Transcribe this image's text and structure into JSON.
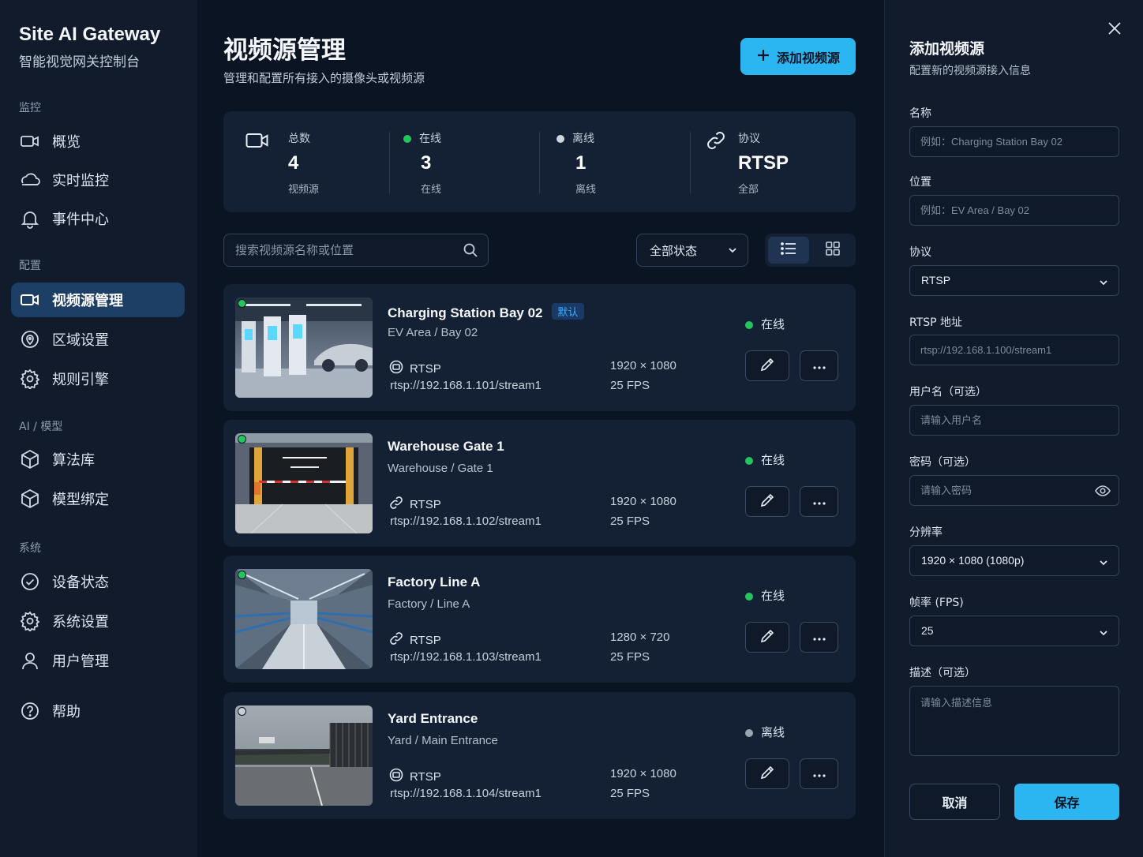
{
  "brand": {
    "title": "Site AI Gateway",
    "subtitle": "智能视觉网关控制台"
  },
  "sidebar": {
    "sections": [
      {
        "label": "监控"
      },
      {
        "label": "配置"
      },
      {
        "label": "AI / 模型"
      },
      {
        "label": "系统"
      }
    ],
    "items": [
      {
        "label": "概览",
        "icon": "video-icon"
      },
      {
        "label": "实时监控",
        "icon": "cloud-icon"
      },
      {
        "label": "事件中心",
        "icon": "bell-icon"
      },
      {
        "label": "视频源管理",
        "icon": "video-icon",
        "active": true
      },
      {
        "label": "区域设置",
        "icon": "map-pin-icon"
      },
      {
        "label": "规则引擎",
        "icon": "gear-icon"
      },
      {
        "label": "算法库",
        "icon": "cube-icon"
      },
      {
        "label": "模型绑定",
        "icon": "cube-icon"
      },
      {
        "label": "设备状态",
        "icon": "check-circle-icon"
      },
      {
        "label": "系统设置",
        "icon": "gear-icon"
      },
      {
        "label": "用户管理",
        "icon": "user-icon"
      },
      {
        "label": "帮助",
        "icon": "help-circle-icon"
      }
    ]
  },
  "header": {
    "title": "视频源管理",
    "subtitle": "管理和配置所有接入的摄像头或视频源",
    "add_label": "添加视频源"
  },
  "stats": {
    "total": {
      "label": "总数",
      "value": "4",
      "sub": "视频源"
    },
    "online": {
      "label": "在线",
      "value": "3",
      "sub": "在线"
    },
    "offline": {
      "label": "离线",
      "value": "1",
      "sub": "离线"
    },
    "protocol": {
      "label": "协议",
      "value": "RTSP",
      "sub": "全部"
    }
  },
  "toolbar": {
    "search_placeholder": "搜索视频源名称或位置",
    "status_filter": "全部状态"
  },
  "sources": [
    {
      "name": "Charging Station Bay 02",
      "badge": "默认",
      "location": "EV Area / Bay 02",
      "protocol": "RTSP",
      "url": "rtsp://192.168.1.101/stream1",
      "resolution": "1920 × 1080",
      "fps": "25 FPS",
      "status": "在线",
      "online": true
    },
    {
      "name": "Warehouse Gate 1",
      "badge": "",
      "location": "Warehouse / Gate 1",
      "protocol": "RTSP",
      "url": "rtsp://192.168.1.102/stream1",
      "resolution": "1920 × 1080",
      "fps": "25 FPS",
      "status": "在线",
      "online": true
    },
    {
      "name": "Factory Line A",
      "badge": "",
      "location": "Factory / Line A",
      "protocol": "RTSP",
      "url": "rtsp://192.168.1.103/stream1",
      "resolution": "1280 × 720",
      "fps": "25 FPS",
      "status": "在线",
      "online": true
    },
    {
      "name": "Yard Entrance",
      "badge": "",
      "location": "Yard / Main Entrance",
      "protocol": "RTSP",
      "url": "rtsp://192.168.1.104/stream1",
      "resolution": "1920 × 1080",
      "fps": "25 FPS",
      "status": "离线",
      "online": false
    }
  ],
  "panel": {
    "title": "添加视频源",
    "subtitle": "配置新的视频源接入信息",
    "fields": {
      "name": {
        "label": "名称",
        "placeholder": "例如：Charging Station Bay 02"
      },
      "location": {
        "label": "位置",
        "placeholder": "例如：EV Area / Bay 02"
      },
      "protocol": {
        "label": "协议",
        "value": "RTSP"
      },
      "rtsp": {
        "label": "RTSP 地址",
        "placeholder": "rtsp://192.168.1.100/stream1"
      },
      "username": {
        "label": "用户名（可选）",
        "placeholder": "请输入用户名"
      },
      "password": {
        "label": "密码（可选）",
        "placeholder": "请输入密码"
      },
      "resolution": {
        "label": "分辨率",
        "value": "1920 × 1080 (1080p)"
      },
      "fps": {
        "label": "帧率 (FPS)",
        "value": "25"
      },
      "description": {
        "label": "描述（可选）",
        "placeholder": "请输入描述信息"
      }
    },
    "cancel_label": "取消",
    "save_label": "保存"
  },
  "colors": {
    "accent": "#2bb6f2",
    "online": "#22c55e",
    "offline": "#9aa4b2",
    "active_nav": "#1d3f66"
  }
}
